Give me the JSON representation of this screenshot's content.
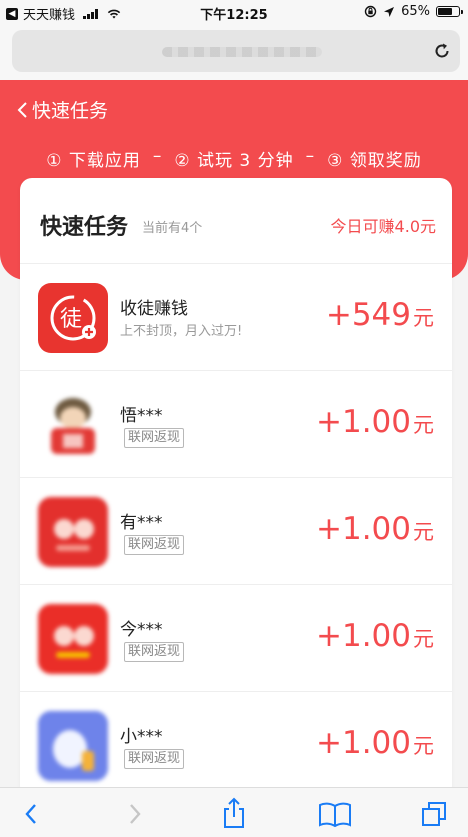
{
  "status_bar": {
    "back_app_glyph": "◀",
    "back_app_label": "天天赚钱",
    "time": "下午12:25",
    "battery_text": "65%",
    "battery_level": 0.65
  },
  "header": {
    "back_label": "快速任务",
    "steps": [
      "① 下载应用",
      "–",
      "② 试玩 3 分钟",
      "–",
      "③ 领取奖励"
    ]
  },
  "card": {
    "title": "快速任务",
    "count_text": "当前有4个",
    "today_earn": "今日可赚4.0元"
  },
  "tasks": [
    {
      "name": "收徒赚钱",
      "desc": "上不封顶，月入过万!",
      "amount": "+549",
      "unit": "元",
      "icon": "recruit-icon"
    },
    {
      "name": "悟***",
      "tag": "联网返现",
      "amount": "+1.00",
      "unit": "元",
      "icon": "app-icon-blurred"
    },
    {
      "name": "有***",
      "tag": "联网返现",
      "amount": "+1.00",
      "unit": "元",
      "icon": "app-icon-blurred"
    },
    {
      "name": "今***",
      "tag": "联网返现",
      "amount": "+1.00",
      "unit": "元",
      "icon": "app-icon-blurred"
    },
    {
      "name": "小***",
      "tag": "联网返现",
      "amount": "+1.00",
      "unit": "元",
      "icon": "app-icon-blurred"
    }
  ],
  "colors": {
    "accent": "#f34b4e",
    "ios_blue": "#1a7cf5"
  }
}
